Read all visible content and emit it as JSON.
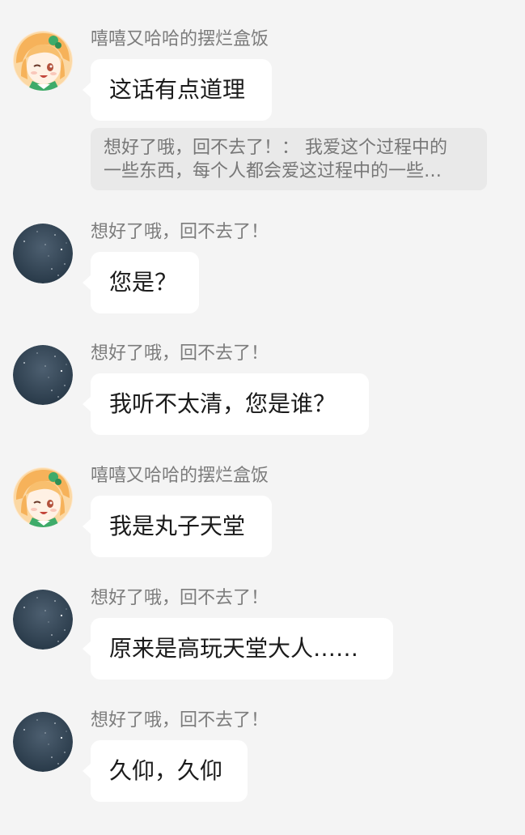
{
  "messages": [
    {
      "sender": "嘻嘻又哈哈的摆烂盒饭",
      "avatar": "anime-girl-avatar",
      "text": "这话有点道理",
      "quote": {
        "line1": "想好了哦，回不去了！：  我爱这个过程中的",
        "line2": "一些东西，每个人都会爱这过程中的一些…"
      }
    },
    {
      "sender": "想好了哦，回不去了！",
      "avatar": "crescent-moon-avatar",
      "text": "您是？"
    },
    {
      "sender": "想好了哦，回不去了！",
      "avatar": "crescent-moon-avatar",
      "text": "我听不太清，您是谁？"
    },
    {
      "sender": "嘻嘻又哈哈的摆烂盒饭",
      "avatar": "anime-girl-avatar",
      "text": "我是丸子天堂"
    },
    {
      "sender": "想好了哦，回不去了！",
      "avatar": "crescent-moon-avatar",
      "text": "原来是高玩天堂大人……"
    },
    {
      "sender": "想好了哦，回不去了！",
      "avatar": "crescent-moon-avatar",
      "text": "久仰，久仰"
    }
  ],
  "colors": {
    "background": "#f4f4f4",
    "bubble": "#ffffff",
    "quote_background": "#e9e9e9",
    "sender_text": "#7c7c7c",
    "message_text": "#1b1b1b"
  }
}
